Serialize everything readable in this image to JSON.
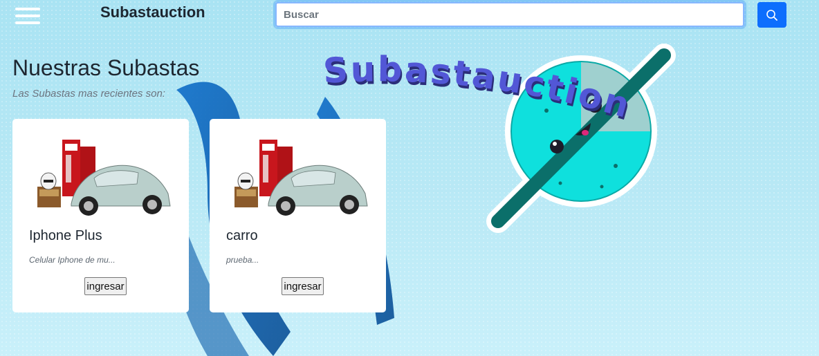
{
  "header": {
    "brand": "Subastauction",
    "search_placeholder": "Buscar"
  },
  "main": {
    "title": "Nuestras Subastas",
    "subtitle": "Las Subastas mas recientes son:"
  },
  "cards": [
    {
      "title": "Iphone Plus",
      "description": "Celular Iphone de mu...",
      "button": "ingresar"
    },
    {
      "title": "carro",
      "description": "prueba...",
      "button": "ingresar"
    }
  ],
  "logo": {
    "text": "Subastauction"
  },
  "colors": {
    "primary": "#0d6efd",
    "logo_text": "#5257d6",
    "planet": "#0fe0dd",
    "ring": "#0b6f6a"
  },
  "icons": {
    "menu": "hamburger-icon",
    "search": "search-icon"
  }
}
